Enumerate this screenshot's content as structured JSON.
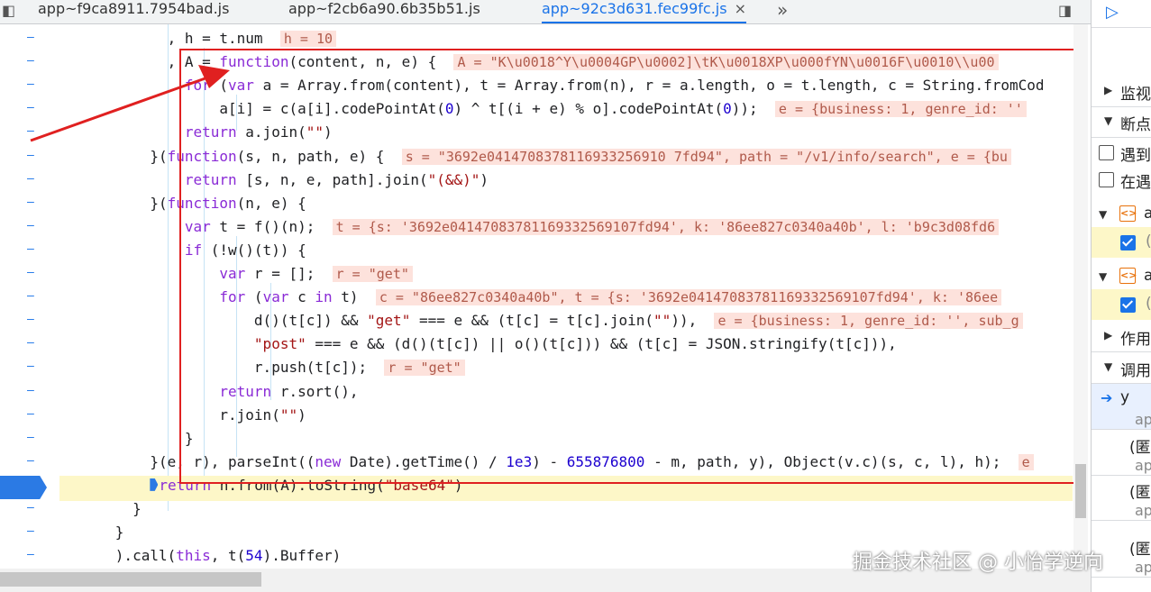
{
  "tabs": [
    {
      "label": "app~f9ca8911.7954bad.js",
      "active": false
    },
    {
      "label": "app~f2cb6a90.6b35b51.js",
      "active": false
    },
    {
      "label": "app~92c3d631.fec99fc.js",
      "active": true
    }
  ],
  "tab_close": "×",
  "tab_more": "»",
  "code_lines": [
    {
      "indent": "        ",
      "text": ", h = t.num",
      "inline": "h = 10"
    },
    {
      "indent": "        ",
      "text": ", A = function(content, n, e) {",
      "inline": "A = \"K\\u0018^Y\\u0004GP\\u0002]\\tK\\u0018XP\\u000fYN\\u0016F\\u0010\\\\u00"
    },
    {
      "indent": "          ",
      "text": "for (var a = Array.from(content), t = Array.from(n), r = a.length, o = t.length, c = String.fromCod",
      "inline": ""
    },
    {
      "indent": "              ",
      "text": "a[i] = c(a[i].codePointAt(0) ^ t[(i + e) % o].codePointAt(0));",
      "inline": "e = {business: 1, genre_id: ''"
    },
    {
      "indent": "          ",
      "text": "return a.join(\"\")",
      "inline": ""
    },
    {
      "indent": "      ",
      "text": "}(function(s, n, path, e) {",
      "inline": "s = \"3692e0414708378116933256910 7fd94\", path = \"/v1/info/search\", e = {bu"
    },
    {
      "indent": "          ",
      "text": "return [s, n, e, path].join(\"(&&)\")",
      "inline": ""
    },
    {
      "indent": "      ",
      "text": "}(function(n, e) {",
      "inline": ""
    },
    {
      "indent": "          ",
      "text": "var t = f()(n);",
      "inline": "t = {s: '3692e04147083781169332569107fd94', k: '86ee827c0340a40b', l: 'b9c3d08fd6"
    },
    {
      "indent": "          ",
      "text": "if (!w()(t)) {",
      "inline": ""
    },
    {
      "indent": "              ",
      "text": "var r = [];",
      "inline": "r = \"get\""
    },
    {
      "indent": "              ",
      "text": "for (var c in t)",
      "inline": "c = \"86ee827c0340a40b\", t = {s: '3692e04147083781169332569107fd94', k: '86ee"
    },
    {
      "indent": "                  ",
      "text": "d()(t[c]) && \"get\" === e && (t[c] = t[c].join(\"\")),",
      "inline": "e = {business: 1, genre_id: '', sub_g"
    },
    {
      "indent": "                  ",
      "text": "\"post\" === e && (d()(t[c]) || o()(t[c])) && (t[c] = JSON.stringify(t[c])),",
      "inline": ""
    },
    {
      "indent": "                  ",
      "text": "r.push(t[c]);",
      "inline": "r = \"get\""
    },
    {
      "indent": "              ",
      "text": "return r.sort(),",
      "inline": ""
    },
    {
      "indent": "              ",
      "text": "r.join(\"\")",
      "inline": ""
    },
    {
      "indent": "          ",
      "text": "}",
      "inline": ""
    },
    {
      "indent": "      ",
      "text": "}(e, r), parseInt((new Date).getTime() / 1e3) - 655876800 - m, path, y), Object(v.c)(s, c, l), h);",
      "inline": "e"
    },
    {
      "indent": "      ",
      "text": "return n.from(A).toString(\"base64\")",
      "inline": "",
      "current": true
    },
    {
      "indent": "    ",
      "text": "}",
      "inline": ""
    },
    {
      "indent": "  ",
      "text": "}",
      "inline": ""
    },
    {
      "indent": "  ",
      "text": ").call(this, t(54).Buffer)",
      "inline": ""
    }
  ],
  "sidebar": {
    "items": [
      {
        "label": "监视",
        "type": "section",
        "collapsed": true
      },
      {
        "label": "断点",
        "type": "section",
        "collapsed": false
      },
      {
        "label": "遇到",
        "type": "checkbox",
        "checked": false
      },
      {
        "label": "在遇",
        "type": "checkbox",
        "checked": false
      },
      {
        "label": "a",
        "type": "file"
      },
      {
        "label": "(",
        "type": "checked-item",
        "checked": true
      },
      {
        "label": "a",
        "type": "file"
      },
      {
        "label": "(",
        "type": "checked-item",
        "checked": true
      },
      {
        "label": "作用",
        "type": "section",
        "collapsed": true
      },
      {
        "label": "调用",
        "type": "section",
        "collapsed": false
      },
      {
        "label": "y",
        "type": "frame",
        "sub": "ap",
        "current": true
      },
      {
        "label": "(匿",
        "type": "frame",
        "sub": "ap"
      },
      {
        "label": "(匿",
        "type": "frame",
        "sub": "ap"
      },
      {
        "label": "(匿",
        "type": "frame",
        "sub": "ap"
      }
    ]
  },
  "watermark": "掘金技术社区 @ 小怡学逆向",
  "colors": {
    "highlight_box": "#e02020",
    "current_line": "#fdf7c8",
    "accent": "#1a73e8",
    "inline_bg": "#fde2dc"
  }
}
